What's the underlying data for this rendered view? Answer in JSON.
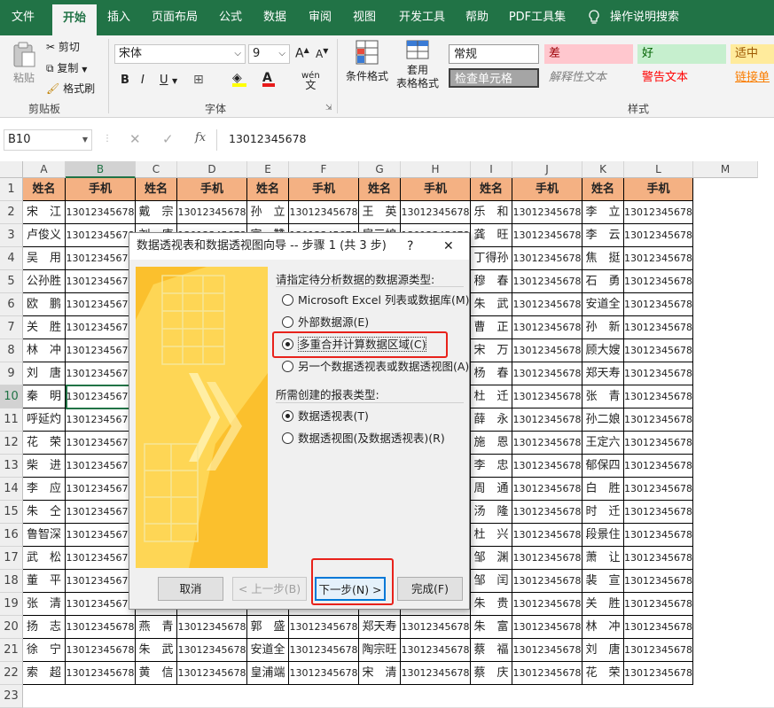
{
  "menubar": {
    "tabs": [
      "文件",
      "开始",
      "插入",
      "页面布局",
      "公式",
      "数据",
      "审阅",
      "视图",
      "开发工具",
      "帮助",
      "PDF工具集"
    ],
    "active_tab": "开始",
    "tell_me": "操作说明搜索",
    "accent": "#217346"
  },
  "ribbon": {
    "clipboard": {
      "paste": "粘贴",
      "cut": "剪切",
      "copy": "复制",
      "format_painter": "格式刷",
      "label": "剪贴板"
    },
    "font": {
      "name": "宋体",
      "size": "9",
      "grow": "A",
      "shrink": "A",
      "bold": "B",
      "italic": "I",
      "underline": "U",
      "phonetic": "wén",
      "label": "字体"
    },
    "styles_group": {
      "conditional": "条件格式",
      "table_format_1": "套用",
      "table_format_2": "表格格式",
      "label": "样式"
    },
    "styles": [
      {
        "text": "常规",
        "bg": "#ffffff",
        "color": "#222222"
      },
      {
        "text": "差",
        "bg": "#ffc7ce",
        "color": "#9c0006"
      },
      {
        "text": "好",
        "bg": "#c6efce",
        "color": "#006100"
      },
      {
        "text": "适中",
        "bg": "#ffeb9c",
        "color": "#9c5700"
      },
      {
        "text": "检查单元格",
        "bg": "#a5a5a5",
        "color": "#ffffff"
      },
      {
        "text": "解释性文本",
        "bg": "#f3f3f3",
        "color": "#7f7f7f"
      },
      {
        "text": "警告文本",
        "bg": "#f3f3f3",
        "color": "#ff0000"
      },
      {
        "text": "链接单",
        "bg": "#f3f3f3",
        "color": "#fa7d00"
      }
    ]
  },
  "formula_bar": {
    "name_box": "B10",
    "fx": "fx",
    "value": "13012345678"
  },
  "sheet": {
    "columns": [
      "A",
      "B",
      "C",
      "D",
      "E",
      "F",
      "G",
      "H",
      "I",
      "J",
      "K",
      "L",
      "M"
    ],
    "selected_col": "B",
    "selected_row": "10",
    "rows": [
      "1",
      "2",
      "3",
      "4",
      "5",
      "6",
      "7",
      "8",
      "9",
      "10",
      "11",
      "12",
      "13",
      "14",
      "15",
      "16",
      "17",
      "18",
      "19",
      "20",
      "21",
      "22",
      "23"
    ],
    "header_name": "姓名",
    "header_phone": "手机",
    "phone": "13012345678",
    "names": [
      [
        "宋　江",
        "戴　宗",
        "孙　立",
        "王　英",
        "乐　和",
        "李　立"
      ],
      [
        "卢俊义",
        "刘　唐",
        "宣　赞",
        "扈三娘",
        "龚　旺",
        "李　云"
      ],
      [
        "吴　用",
        "",
        "",
        "",
        "丁得孙",
        "焦　挺"
      ],
      [
        "公孙胜",
        "",
        "",
        "",
        "穆　春",
        "石　勇"
      ],
      [
        "欧　鹏",
        "",
        "",
        "",
        "朱　武",
        "安道全"
      ],
      [
        "关　胜",
        "",
        "",
        "",
        "曹　正",
        "孙　新"
      ],
      [
        "林　冲",
        "",
        "",
        "",
        "宋　万",
        "顾大嫂"
      ],
      [
        "刘　唐",
        "",
        "",
        "",
        "杨　春",
        "郑天寿"
      ],
      [
        "秦　明",
        "",
        "",
        "",
        "杜　迁",
        "张　青"
      ],
      [
        "呼延灼",
        "",
        "",
        "",
        "薛　永",
        "孙二娘"
      ],
      [
        "花　荣",
        "",
        "",
        "",
        "施　恩",
        "王定六"
      ],
      [
        "柴　进",
        "",
        "",
        "",
        "李　忠",
        "郁保四"
      ],
      [
        "李　应",
        "",
        "",
        "",
        "周　通",
        "白　胜"
      ],
      [
        "朱　仝",
        "",
        "",
        "",
        "汤　隆",
        "时　迁"
      ],
      [
        "鲁智深",
        "",
        "",
        "",
        "杜　兴",
        "段景住"
      ],
      [
        "武　松",
        "",
        "",
        "",
        "邹　渊",
        "萧　让"
      ],
      [
        "董　平",
        "",
        "",
        "",
        "邹　闰",
        "裴　宣"
      ],
      [
        "张　清",
        "",
        "",
        "",
        "朱　贵",
        "关　胜"
      ],
      [
        "扬　志",
        "燕　青",
        "郭　盛",
        "郑天寿",
        "朱　富",
        "林　冲"
      ],
      [
        "徐　宁",
        "朱　武",
        "安道全",
        "陶宗旺",
        "蔡　福",
        "刘　唐"
      ],
      [
        "索　超",
        "黄　信",
        "皇浦端",
        "宋　清",
        "蔡　庆",
        "花　荣"
      ]
    ]
  },
  "dialog": {
    "title": "数据透视表和数据透视图向导 -- 步骤 1 (共 3 步)",
    "help": "?",
    "close": "✕",
    "source_prompt": "请指定待分析数据的数据源类型:",
    "source_options": [
      "Microsoft Excel 列表或数据库(M)",
      "外部数据源(E)",
      "多重合并计算数据区域(C)",
      "另一个数据透视表或数据透视图(A)"
    ],
    "source_selected": 2,
    "report_prompt": "所需创建的报表类型:",
    "report_options": [
      "数据透视表(T)",
      "数据透视图(及数据透视表)(R)"
    ],
    "report_selected": 0,
    "buttons": {
      "cancel": "取消",
      "back": "< 上一步(B)",
      "next": "下一步(N) >",
      "finish": "完成(F)"
    }
  }
}
